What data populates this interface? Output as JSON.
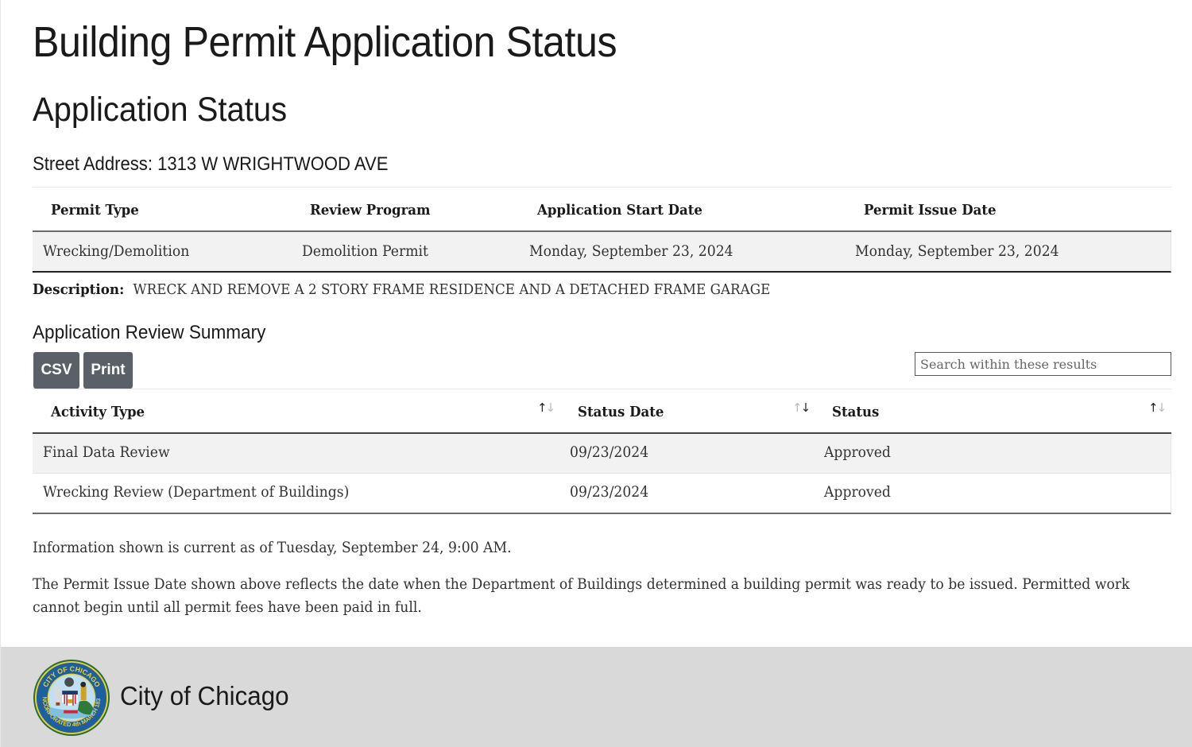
{
  "page": {
    "title": "Building Permit Application Status",
    "section_title": "Application Status",
    "address": "Street Address: 1313 W WRIGHTWOOD AVE"
  },
  "permit_table": {
    "columns": [
      "Permit Type",
      "Review Program",
      "Application Start Date",
      "Permit Issue Date"
    ],
    "rows": [
      [
        "Wrecking/Demolition",
        "Demolition Permit",
        "Monday, September 23, 2024",
        "Monday, September 23, 2024"
      ]
    ]
  },
  "description": {
    "label": "Description:",
    "value": "WRECK AND REMOVE A 2 STORY FRAME RESIDENCE AND A DETACHED FRAME GARAGE"
  },
  "review_summary": {
    "title": "Application Review Summary",
    "buttons": {
      "csv": "CSV",
      "print": "Print"
    },
    "search": {
      "placeholder": "Search within these results",
      "value": ""
    },
    "columns": [
      {
        "label": "Activity Type",
        "sort_icon": "sort-asc-icon",
        "sort": "ascending"
      },
      {
        "label": "Status Date",
        "sort_icon": "sort-icon",
        "sort": "none"
      },
      {
        "label": "Status",
        "sort_icon": "sort-icon",
        "sort": "none"
      }
    ],
    "rows": [
      [
        "Final Data Review",
        "09/23/2024",
        "Approved"
      ],
      [
        "Wrecking Review (Department of Buildings)",
        "09/23/2024",
        "Approved"
      ]
    ]
  },
  "notes": {
    "current_as_of": "Information shown is current as of Tuesday, September 24, 9:00 AM.",
    "issue_date_note": "The Permit Issue Date shown above reflects the date when the Department of Buildings determined a building permit was ready to be issued. Permitted work cannot begin until all permit fees have been paid in full."
  },
  "footer": {
    "logo_icon": "city-of-chicago-seal-icon",
    "seal_text_top": "CITY OF CHICAGO",
    "seal_text_bottom": "INCORPORATED 4th MARCH 1837",
    "title": "City of Chicago"
  },
  "colors": {
    "button_bg": "#5a5f68",
    "footer_bg": "#d9d9d9",
    "row_stripe": "#f2f2f2",
    "seal_blue": "#1f5f9e",
    "seal_gold": "#e5d13a"
  }
}
